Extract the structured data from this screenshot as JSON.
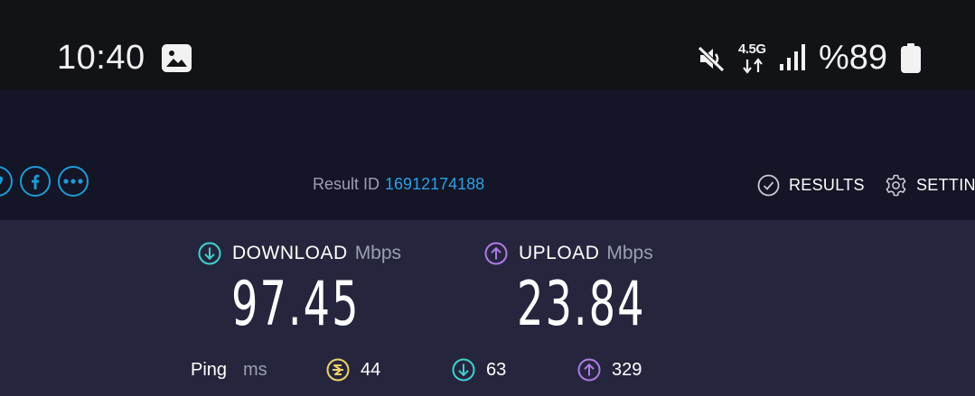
{
  "status_bar": {
    "time": "10:40",
    "network": "4.5G",
    "battery": "%89",
    "icons": [
      "gallery-icon",
      "mute-icon",
      "data-arrows-icon",
      "signal-icon",
      "battery-icon"
    ]
  },
  "header": {
    "share_icons": [
      "twitter-icon",
      "facebook-icon",
      "more-icon"
    ],
    "result_id_label": "Result ID",
    "result_id_value": "16912174188",
    "nav": {
      "results_label": "RESULTS",
      "settings_label": "SETTINGS"
    }
  },
  "results": {
    "download": {
      "label": "DOWNLOAD",
      "unit": "Mbps",
      "value": "97.45",
      "color": "#3fd1d1"
    },
    "upload": {
      "label": "UPLOAD",
      "unit": "Mbps",
      "value": "23.84",
      "color": "#b07ae6"
    },
    "ping": {
      "label": "Ping",
      "unit": "ms",
      "jitter_value": "44",
      "download_value": "63",
      "upload_value": "329",
      "jitter_color": "#f0d26a"
    }
  },
  "colors": {
    "background": "#141526",
    "panel": "#25263d",
    "accent_blue": "#2f9ee6"
  }
}
